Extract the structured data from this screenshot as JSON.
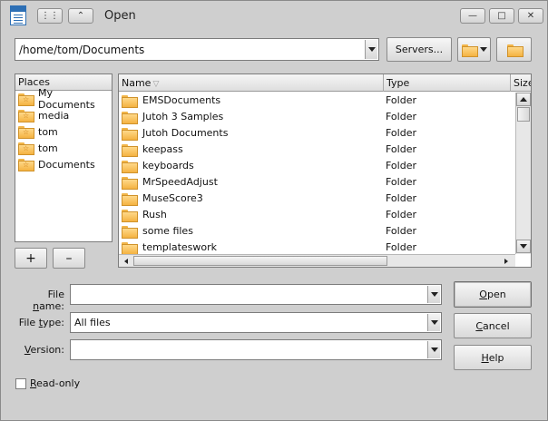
{
  "window": {
    "title": "Open"
  },
  "path_bar": {
    "path": "/home/tom/Documents",
    "servers_label": "Servers..."
  },
  "places": {
    "header": "Places",
    "items": [
      {
        "label": "My Documents",
        "icon": "folder-star-icon"
      },
      {
        "label": "media",
        "icon": "folder-star-icon"
      },
      {
        "label": "tom",
        "icon": "folder-star-icon"
      },
      {
        "label": "tom",
        "icon": "folder-star-icon"
      },
      {
        "label": "Documents",
        "icon": "folder-star-icon"
      }
    ],
    "add_label": "+",
    "remove_label": "–"
  },
  "files": {
    "columns": {
      "name": "Name",
      "type": "Type",
      "size": "Size"
    },
    "rows": [
      {
        "name": "EMSDocuments",
        "type": "Folder"
      },
      {
        "name": "Jutoh 3 Samples",
        "type": "Folder"
      },
      {
        "name": "Jutoh Documents",
        "type": "Folder"
      },
      {
        "name": "keepass",
        "type": "Folder"
      },
      {
        "name": "keyboards",
        "type": "Folder"
      },
      {
        "name": "MrSpeedAdjust",
        "type": "Folder"
      },
      {
        "name": "MuseScore3",
        "type": "Folder"
      },
      {
        "name": "Rush",
        "type": "Folder"
      },
      {
        "name": "some files",
        "type": "Folder"
      },
      {
        "name": "templateswork",
        "type": "Folder"
      }
    ]
  },
  "form": {
    "file_name_label_pre": "File ",
    "file_name_label_u": "n",
    "file_name_label_post": "ame:",
    "file_name_value": "",
    "file_type_label_pre": "File ",
    "file_type_label_u": "t",
    "file_type_label_post": "ype:",
    "file_type_value": "All files",
    "version_label_pre": "",
    "version_label_u": "V",
    "version_label_post": "ersion:",
    "version_value": "",
    "readonly_label_pre": "",
    "readonly_label_u": "R",
    "readonly_label_post": "ead-only",
    "readonly_checked": false
  },
  "buttons": {
    "open_u": "O",
    "open_rest": "pen",
    "cancel_u": "C",
    "cancel_rest": "ancel",
    "help_u": "H",
    "help_rest": "elp"
  },
  "colors": {
    "window_bg": "#cfcfcf",
    "folder_fill": "#f4b241",
    "doc_icon_blue": "#2d6fb5"
  }
}
